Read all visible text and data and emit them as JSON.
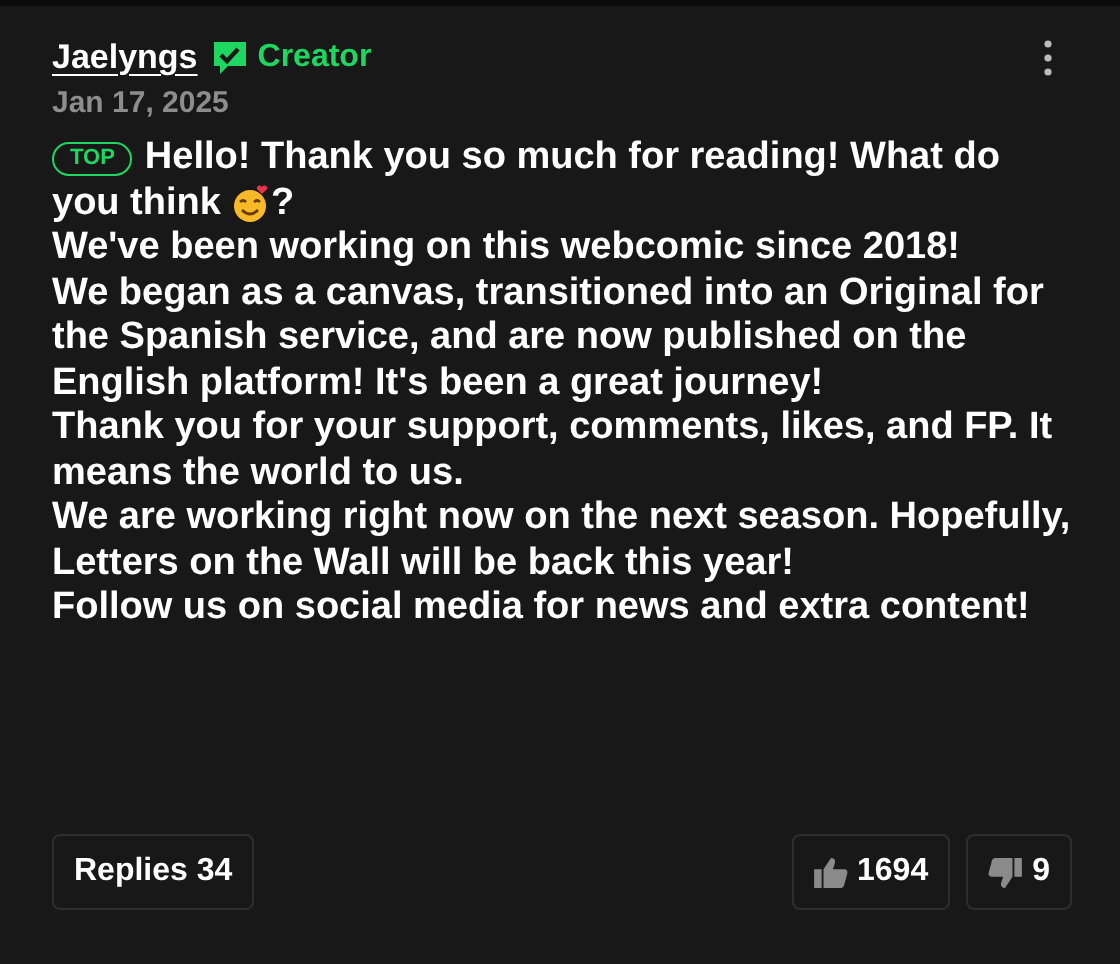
{
  "comment": {
    "author": "Jaelyngs",
    "verified": true,
    "role": "Creator",
    "date": "Jan 17, 2025",
    "badge": "TOP",
    "lead": "Hello! Thank you so much for reading! What do",
    "lead_2": "you think",
    "lead_end": "?",
    "paragraphs": [
      "We've been working on this webcomic since 2018!",
      "We began as a canvas, transitioned into an Original for the Spanish service, and are now published on the English platform! It's been a great journey!",
      "Thank you for your support, comments, likes, and FP. It means the world to us.",
      "We are working right now on the next season. Hopefully, Letters on the Wall will be back this year!",
      "Follow us on social media for news and extra content!"
    ]
  },
  "footer": {
    "replies": "Replies 34",
    "likes": "1694",
    "dislikes": "9"
  }
}
